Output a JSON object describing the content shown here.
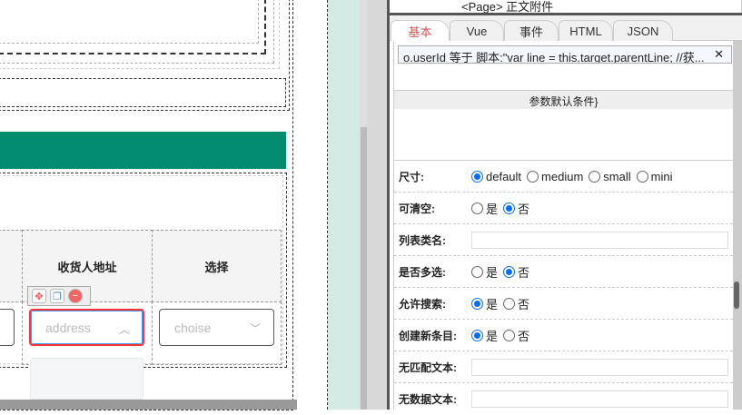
{
  "canvas": {
    "table_headers": [
      "收货人地址",
      "选择"
    ],
    "address_placeholder": "address",
    "choise_placeholder": "choise",
    "accent": "#038c70"
  },
  "tree": {
    "node": "<Page> 正文附件"
  },
  "tabs": [
    {
      "label": "基本",
      "active": true
    },
    {
      "label": "Vue"
    },
    {
      "label": "事件"
    },
    {
      "label": "HTML"
    },
    {
      "label": "JSON"
    }
  ],
  "condition": {
    "text": "o.userId 等于 脚本:\"var line = this.target.parentLine; //获...",
    "close": "✕"
  },
  "section_title": "参数默认条件}",
  "props": {
    "size": {
      "label": "尺寸:",
      "options": [
        "default",
        "medium",
        "small",
        "mini"
      ],
      "selected": "default"
    },
    "clearable": {
      "label": "可清空:",
      "yes": "是",
      "no": "否",
      "selected": "否"
    },
    "list_class": {
      "label": "列表类名:",
      "value": ""
    },
    "multiple": {
      "label": "是否多选:",
      "yes": "是",
      "no": "否",
      "selected": "否"
    },
    "filterable": {
      "label": "允许搜索:",
      "yes": "是",
      "no": "否",
      "selected": "是"
    },
    "allow_create": {
      "label": "创建新条目:",
      "yes": "是",
      "no": "否",
      "selected": "是"
    },
    "no_match_text": {
      "label": "无匹配文本:",
      "value": ""
    },
    "no_data_text": {
      "label": "无数据文本:",
      "value": ""
    }
  }
}
